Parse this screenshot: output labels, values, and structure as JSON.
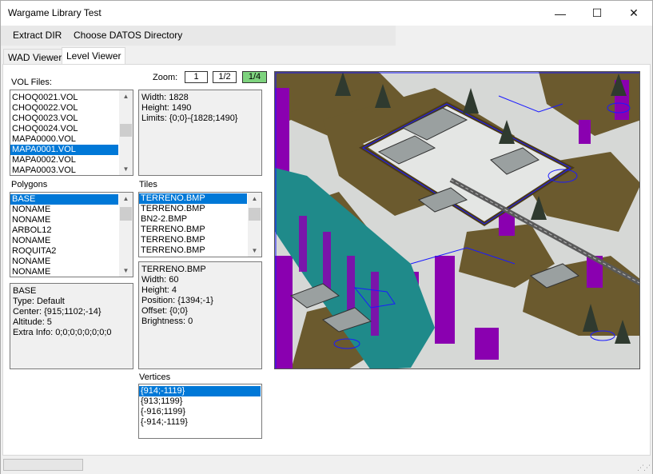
{
  "window": {
    "title": "Wargame Library Test",
    "minimize_glyph": "—",
    "maximize_glyph": "☐",
    "close_glyph": "✕"
  },
  "menu": {
    "extract": "Extract DIR",
    "choose": "Choose DATOS Directory"
  },
  "tabs": [
    {
      "label": "WAD Viewer"
    },
    {
      "label": "Level Viewer"
    }
  ],
  "vol_files": {
    "label": "VOL Files:",
    "items": [
      "CHOQ0021.VOL",
      "CHOQ0022.VOL",
      "CHOQ0023.VOL",
      "CHOQ0024.VOL",
      "MAPA0000.VOL",
      "MAPA0001.VOL",
      "MAPA0002.VOL",
      "MAPA0003.VOL"
    ],
    "selected_index": 5
  },
  "zoom": {
    "label": "Zoom:",
    "options": [
      "1",
      "1/2",
      "1/4"
    ],
    "active": "1/4"
  },
  "map_info": [
    "Width: 1828",
    "Height: 1490",
    "Limits: {0;0}-{1828;1490}"
  ],
  "polygons": {
    "label": "Polygons",
    "items": [
      "BASE",
      "NONAME",
      "NONAME",
      "ARBOL12",
      "NONAME",
      "ROQUITA2",
      "NONAME",
      "NONAME"
    ],
    "selected_index": 0
  },
  "polygon_info": [
    "BASE",
    "Type: Default",
    "Center: {915;1102;-14}",
    "Altitude: 5",
    "Extra Info: 0;0;0;0;0;0;0;0"
  ],
  "tiles": {
    "label": "Tiles",
    "items": [
      "TERRENO.BMP",
      "TERRENO.BMP",
      "BN2-2.BMP",
      "TERRENO.BMP",
      "TERRENO.BMP",
      "TERRENO.BMP"
    ],
    "selected_index": 0
  },
  "tile_info": [
    "TERRENO.BMP",
    "Width: 60",
    "Height: 4",
    "Position: {1394;-1}",
    "Offset: {0;0}",
    "Brightness: 0"
  ],
  "vertices": {
    "label": "Vertices",
    "items": [
      "{914;-1119}",
      "{913;1199}",
      "{-916;1199}",
      "{-914;-1119}"
    ],
    "selected_index": 0
  },
  "colors": {
    "selection": "#0078d7",
    "zoom_active": "#7ed37e",
    "polygon_outline": "#1a1aff",
    "overlay_magenta": "#8a00b0",
    "overlay_teal": "#1f8a8a",
    "snow": "#e4e6e4",
    "dirt": "#6b5a2e"
  }
}
